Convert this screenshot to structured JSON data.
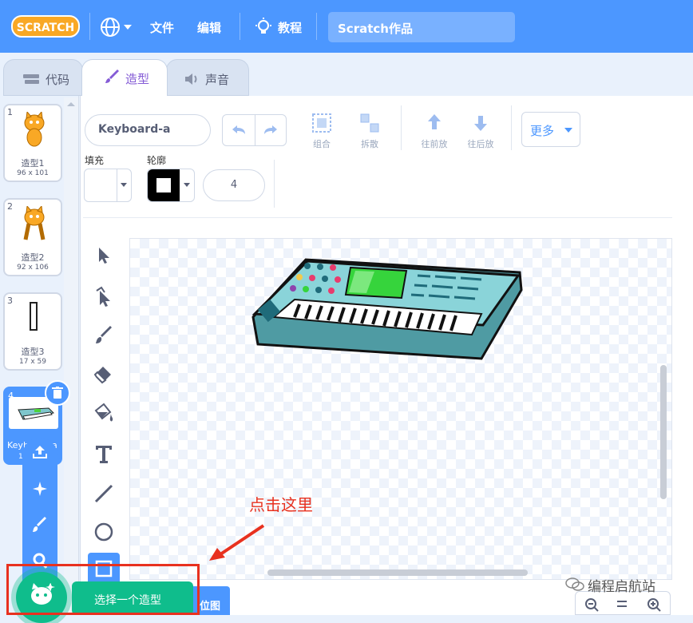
{
  "menubar": {
    "logo": "SCRATCH",
    "file": "文件",
    "edit": "编辑",
    "tutorials": "教程",
    "project_title": "Scratch作品"
  },
  "tabs": [
    {
      "label": "代码"
    },
    {
      "label": "造型"
    },
    {
      "label": "声音"
    }
  ],
  "costumes": [
    {
      "num": "1",
      "name": "造型1",
      "size": "96 x 101"
    },
    {
      "num": "2",
      "name": "造型2",
      "size": "92 x 106"
    },
    {
      "num": "3",
      "name": "造型3",
      "size": "17 x 59"
    },
    {
      "num": "4",
      "name": "Keyb",
      "name_tail": "a",
      "size": "1"
    }
  ],
  "editor": {
    "costume_name": "Keyboard-a",
    "group": "组合",
    "ungroup": "拆散",
    "forward": "往前放",
    "backward": "往后放",
    "more": "更多",
    "fill_label": "填充",
    "outline_label": "轮廓",
    "outline_width": "4",
    "bitmap_partial": "位图"
  },
  "annotation": {
    "callout": "点击这里"
  },
  "choose_costume_tooltip": "选择一个造型",
  "watermark": "编程启航站",
  "colors": {
    "menubar": "#4c97ff",
    "accent": "#855cd6",
    "add_button": "#0fbd8c",
    "popup_menu": "#4c97ff",
    "annotation": "#e8311f"
  }
}
